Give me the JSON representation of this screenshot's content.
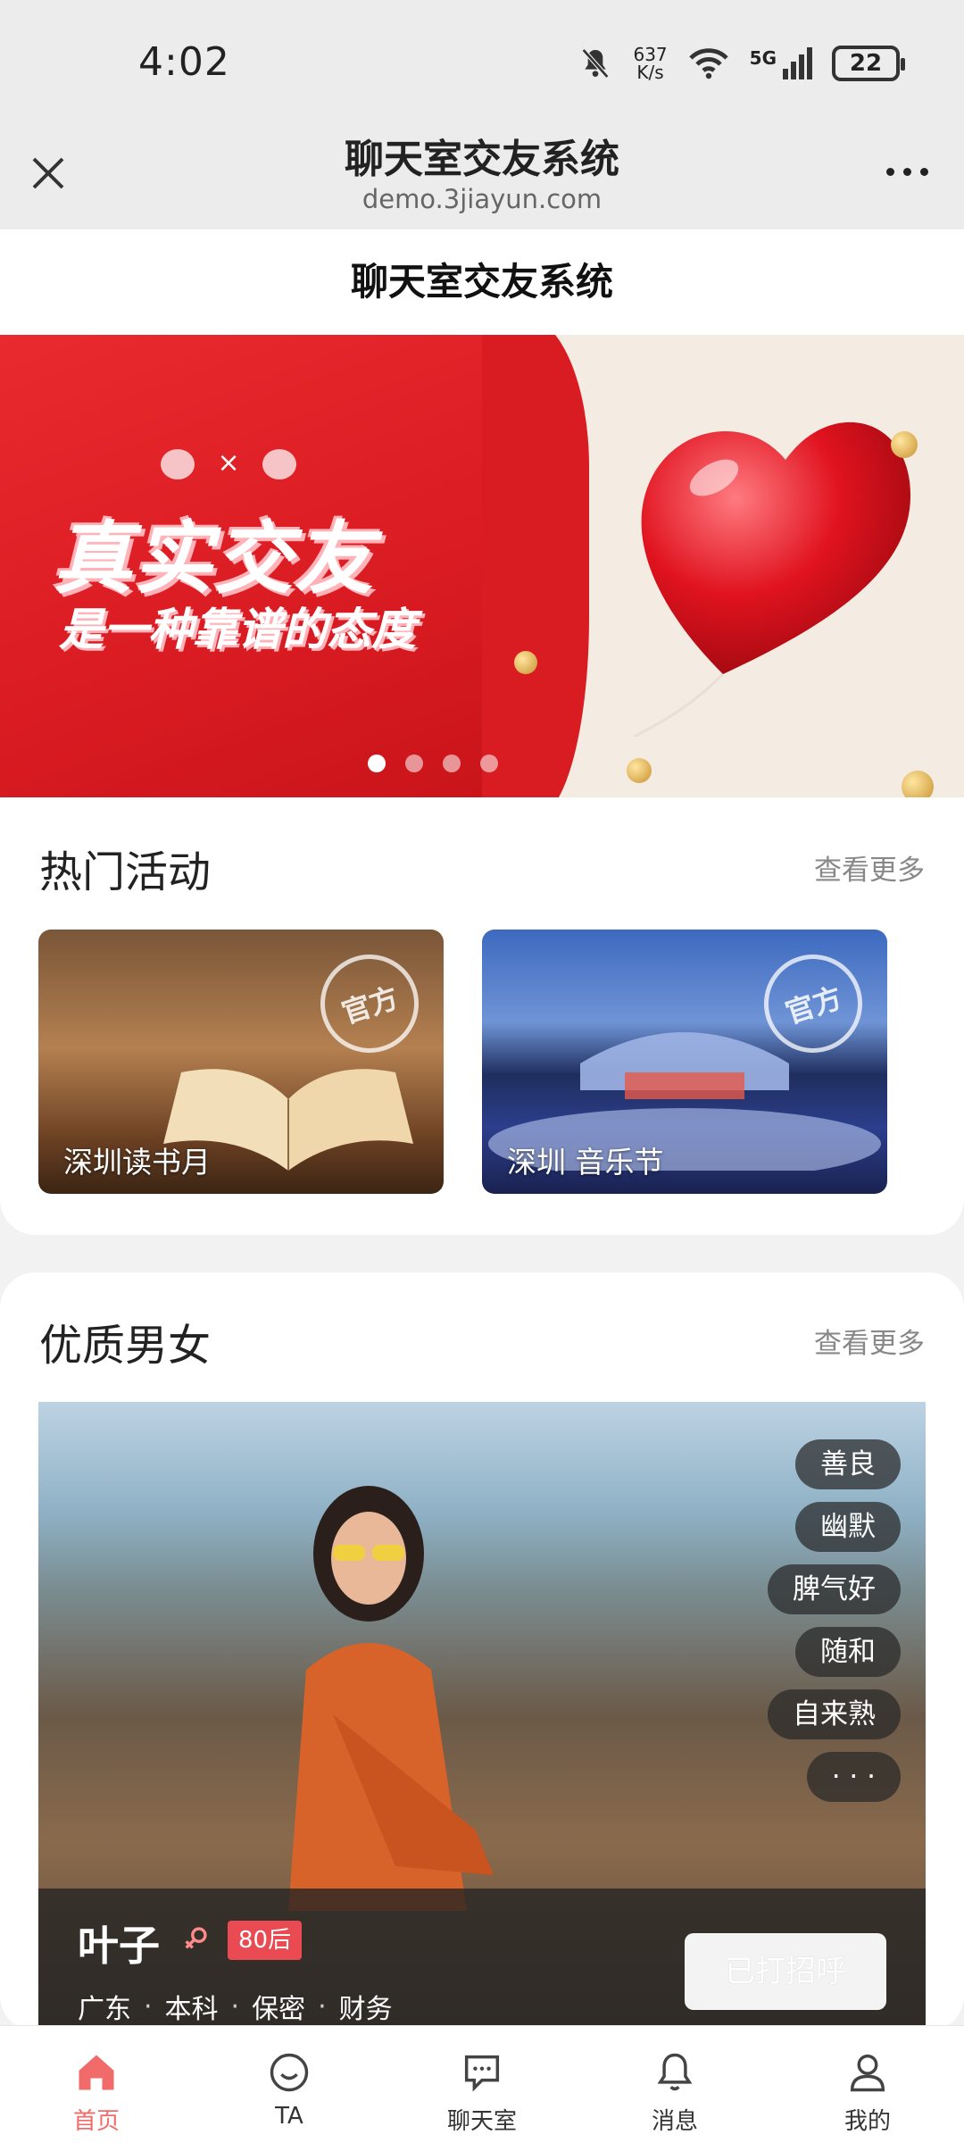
{
  "status_bar": {
    "time": "4:02",
    "net_speed_value": "637",
    "net_speed_unit": "K/s",
    "signal_label": "5G",
    "battery": "22"
  },
  "browser": {
    "title": "聊天室交友系统",
    "url": "demo.3jiayun.com"
  },
  "page": {
    "header_title": "聊天室交友系统"
  },
  "banner": {
    "mascot_separator": "×",
    "title": "真实交友",
    "subtitle": "是一种靠谱的态度",
    "slide_count": 4,
    "active_slide": 1
  },
  "hot_activities": {
    "title": "热门活动",
    "more_label": "查看更多",
    "items": [
      {
        "label": "深圳读书月",
        "stamp": "官方"
      },
      {
        "label": "深圳 音乐节",
        "stamp": "官方"
      }
    ]
  },
  "quality": {
    "title": "优质男女",
    "more_label": "查看更多",
    "profile": {
      "name": "叶子",
      "age_badge": "80后",
      "meta": [
        "广东",
        "本科",
        "保密",
        "财务"
      ],
      "meta_separator": "·",
      "tags": [
        "善良",
        "幽默",
        "脾气好",
        "随和",
        "自来熟",
        "· · ·"
      ],
      "greet_button": "已打招呼"
    }
  },
  "bottom_nav": {
    "items": [
      {
        "label": "首页",
        "icon": "home-icon",
        "active": true
      },
      {
        "label": "TA",
        "icon": "smile-icon",
        "active": false
      },
      {
        "label": "聊天室",
        "icon": "chat-icon",
        "active": false
      },
      {
        "label": "消息",
        "icon": "bell-icon",
        "active": false
      },
      {
        "label": "我的",
        "icon": "user-icon",
        "active": false
      }
    ]
  },
  "colors": {
    "accent": "#f26b6b",
    "banner_red": "#d91b22",
    "badge_red": "#ea4a52"
  }
}
